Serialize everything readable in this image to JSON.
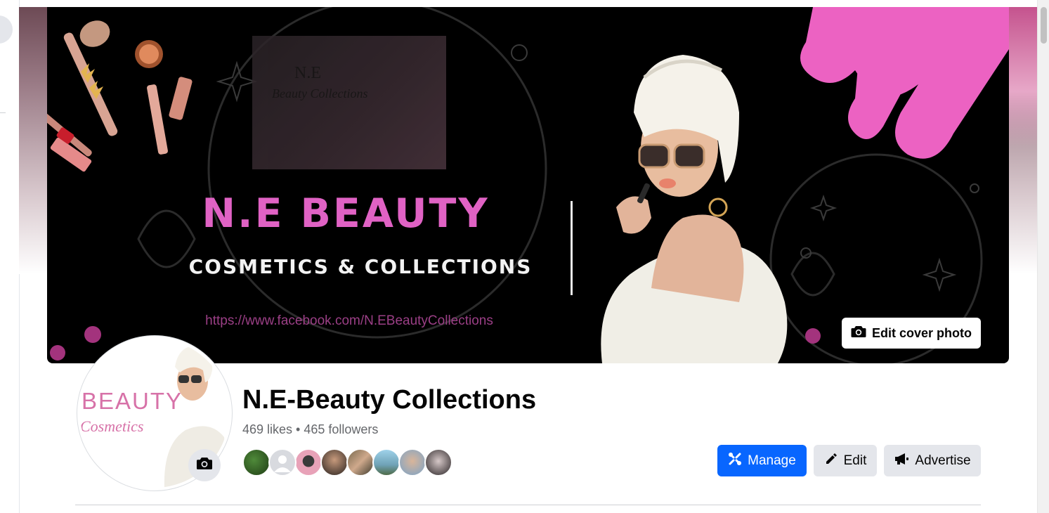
{
  "cover": {
    "title": "N.E BEAUTY",
    "subtitle": "COSMETICS & COLLECTIONS",
    "url_text": "https://www.facebook.com/N.EBeautyCollections",
    "inset_logo_line1": "N.E",
    "inset_logo_line2": "Beauty Collections",
    "edit_cover_label": "Edit cover photo",
    "camera_icon": "camera-icon"
  },
  "profile": {
    "picture_text_line1": "BEAUTY",
    "picture_text_line2": "Cosmetics",
    "page_name": "N.E-Beauty Collections",
    "likes": "469 likes",
    "separator": " • ",
    "followers": "465 followers",
    "follower_avatar_count": 8
  },
  "actions": {
    "manage_label": "Manage",
    "edit_label": "Edit",
    "advertise_label": "Advertise"
  },
  "colors": {
    "accent_blue": "#0866ff",
    "brand_pink": "#e062c4",
    "button_grey": "#e4e6eb",
    "text_primary": "#050505",
    "text_secondary": "#65676b"
  }
}
